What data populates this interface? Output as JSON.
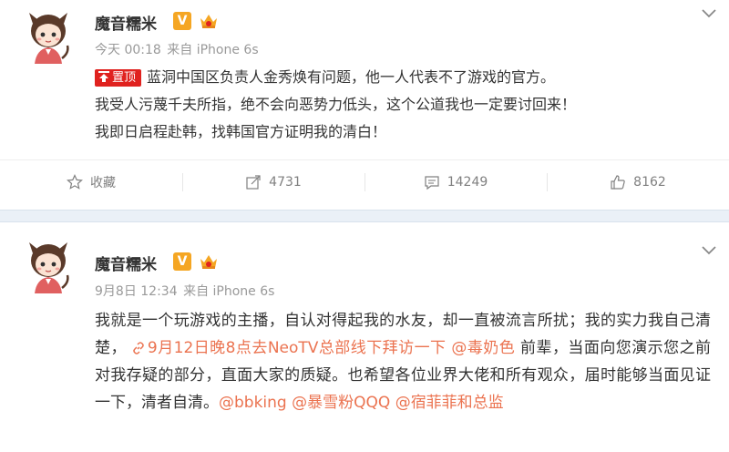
{
  "colors": {
    "link": "#eb7350",
    "pin": "#e0221f",
    "badge_v": "#f5a623",
    "separator": "#eaf0f7"
  },
  "post1": {
    "user": {
      "name": "魔音糯米",
      "verified_badge": "V"
    },
    "meta": {
      "time": "今天 00:18",
      "source": "来自 iPhone 6s"
    },
    "pin_label": "置顶",
    "lines": [
      "蓝洞中国区负责人金秀焕有问题，他一人代表不了游戏的官方。",
      "我受人污蔑千夫所指，绝不会向恶势力低头，这个公道我也一定要讨回来！",
      "我即日启程赴韩，找韩国官方证明我的清白！"
    ],
    "actions": {
      "favorite_label": "收藏",
      "repost_count": "4731",
      "comment_count": "14249",
      "like_count": "8162"
    },
    "icons": [
      "star-icon",
      "repost-icon",
      "comment-icon",
      "like-icon",
      "chevron-down-icon",
      "pin-icon"
    ]
  },
  "post2": {
    "user": {
      "name": "魔音糯米",
      "verified_badge": "V"
    },
    "meta": {
      "time": "9月8日 12:34",
      "source": "来自 iPhone 6s"
    },
    "text_1": "我就是一个玩游戏的主播，自认对得起我的水友，却一直被流言所扰；我的实力我自己清楚，",
    "event_link": "9月12日晚8点去NeoTV总部线下拜访一下",
    "mention_1": "@毒奶色",
    "text_2": "前辈，当面向您演示您之前对我存疑的部分，直面大家的质疑。也希望各位业界大佬和所有观众，届时能够当面见证一下，清者自清。",
    "mention_2": "@bbking",
    "mention_3": "@暴雪粉QQQ",
    "mention_4": "@宿菲菲和总监",
    "icons": [
      "link-icon",
      "chevron-down-icon"
    ]
  }
}
